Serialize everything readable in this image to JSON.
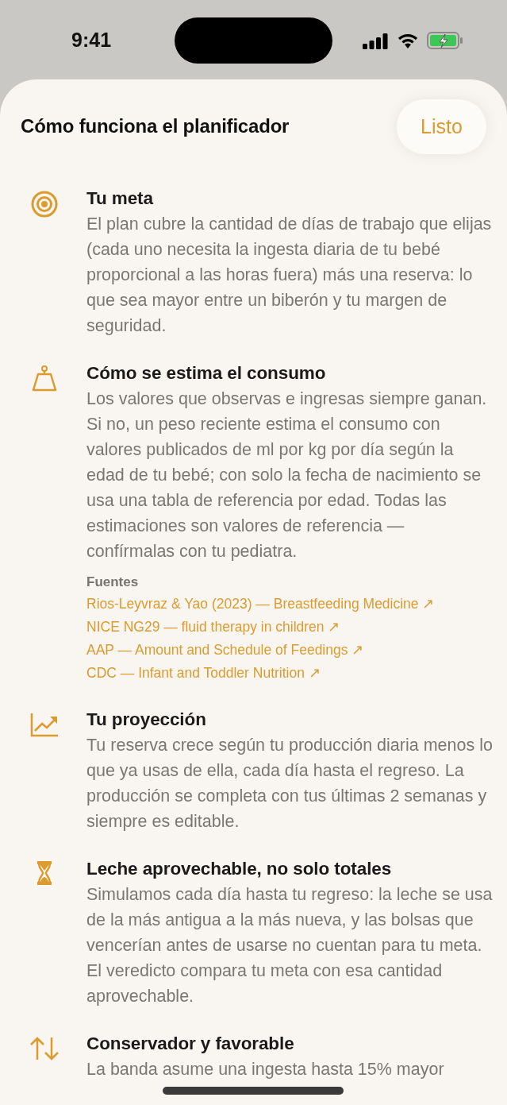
{
  "status_bar": {
    "time": "9:41"
  },
  "sheet": {
    "title": "Cómo funciona el planificador",
    "done_button": "Listo"
  },
  "sections": [
    {
      "kind": "target",
      "heading": "Tu meta",
      "body": "El plan cubre la cantidad de días de trabajo que elijas (cada uno necesita la ingesta diaria de tu bebé proporcional a las horas fuera) más una reserva: lo que sea mayor entre un biberón y tu margen de seguridad."
    },
    {
      "kind": "weight",
      "heading": "Cómo se estima el consumo",
      "body": "Los valores que observas e ingresas siempre ganan. Si no, un peso reciente estima el consumo con valores publicados de ml por kg por día según la edad de tu bebé; con solo la fecha de nacimiento se usa una tabla de referencia por edad. Todas las estimaciones son valores de referencia — confírmalas con tu pediatra.",
      "sources": {
        "heading": "Fuentes",
        "links": [
          "Rios-Leyvraz & Yao (2023) — Breastfeeding Medicine ↗",
          "NICE NG29 — fluid therapy in children ↗",
          "AAP — Amount and Schedule of Feedings ↗",
          "CDC — Infant and Toddler Nutrition ↗"
        ]
      }
    },
    {
      "kind": "chart",
      "heading": "Tu proyección",
      "body": "Tu reserva crece según tu producción diaria menos lo que ya usas de ella, cada día hasta el regreso. La producción se completa con tus últimas 2 semanas y siempre es editable."
    },
    {
      "kind": "hourglass",
      "heading": "Leche aprovechable, no solo totales",
      "body": "Simulamos cada día hasta tu regreso: la leche se usa de la más antigua a la más nueva, y las bolsas que vencerían antes de usarse no cuentan para tu meta. El veredicto compara tu meta con esa cantidad aprovechable."
    },
    {
      "kind": "arrows",
      "heading": "Conservador y favorable",
      "body": "La banda asume una ingesta hasta 15% mayor"
    }
  ]
}
